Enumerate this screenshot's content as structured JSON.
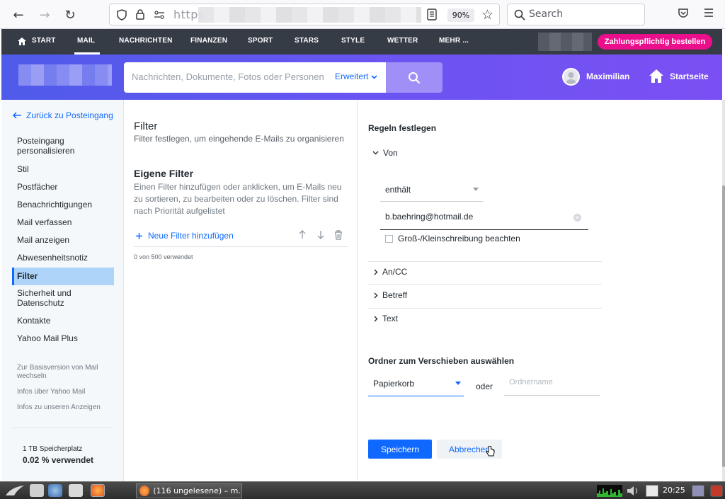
{
  "browser": {
    "url_text": "https",
    "zoom": "90%",
    "search_placeholder": "Search"
  },
  "nav": {
    "items": [
      "START",
      "MAIL",
      "NACHRICHTEN",
      "FINANZEN",
      "SPORT",
      "STARS",
      "STYLE",
      "WETTER",
      "MEHR ..."
    ],
    "active": "MAIL",
    "premium_label": "Zahlungspflichtig bestellen"
  },
  "header": {
    "search_placeholder": "Nachrichten, Dokumente, Fotos oder Personen",
    "advanced_label": "Erweitert",
    "user_name": "Maximilian",
    "home_label": "Startseite"
  },
  "sidebar": {
    "back_label": "Zurück zu Posteingang",
    "items": [
      "Posteingang personalisieren",
      "Stil",
      "Postfächer",
      "Benachrichtigungen",
      "Mail verfassen",
      "Mail anzeigen",
      "Abwesenheitsnotiz",
      "Filter",
      "Sicherheit und Datenschutz",
      "Kontakte",
      "Yahoo Mail Plus"
    ],
    "active_item": "Filter",
    "links": [
      "Zur Basisversion von Mail wechseln",
      "Infos über Yahoo Mail",
      "Infos zu unseren Anzeigen"
    ],
    "storage_label": "1 TB Speicherplatz",
    "storage_value": "0.02 % verwendet"
  },
  "filters": {
    "title": "Filter",
    "subtitle": "Filter festlegen, um eingehende E-Mails zu organisieren",
    "own_title": "Eigene Filter",
    "own_desc": "Einen Filter hinzufügen oder anklicken, um E-Mails neu zu sortieren, zu bearbeiten oder zu löschen. Filter sind nach Priorität aufgelistet",
    "add_label": "Neue Filter hinzufügen",
    "used_count": "0 von 500 verwendet"
  },
  "rules": {
    "heading": "Regeln festlegen",
    "from_label": "Von",
    "condition": "enthält",
    "email_value": "b.baehring@hotmail.de",
    "case_label": "Groß-/Kleinschreibung beachten",
    "case_checked": false,
    "ancc_label": "An/CC",
    "subject_label": "Betreff",
    "text_label": "Text",
    "folder_heading": "Ordner zum Verschieben auswählen",
    "folder_value": "Papierkorb",
    "or_label": "oder",
    "folder_name_placeholder": "Ordnername",
    "save_label": "Speichern",
    "cancel_label": "Abbrechen"
  },
  "taskbar": {
    "window_title": "(116 ungelesene) – m...",
    "clock": "20:25"
  }
}
